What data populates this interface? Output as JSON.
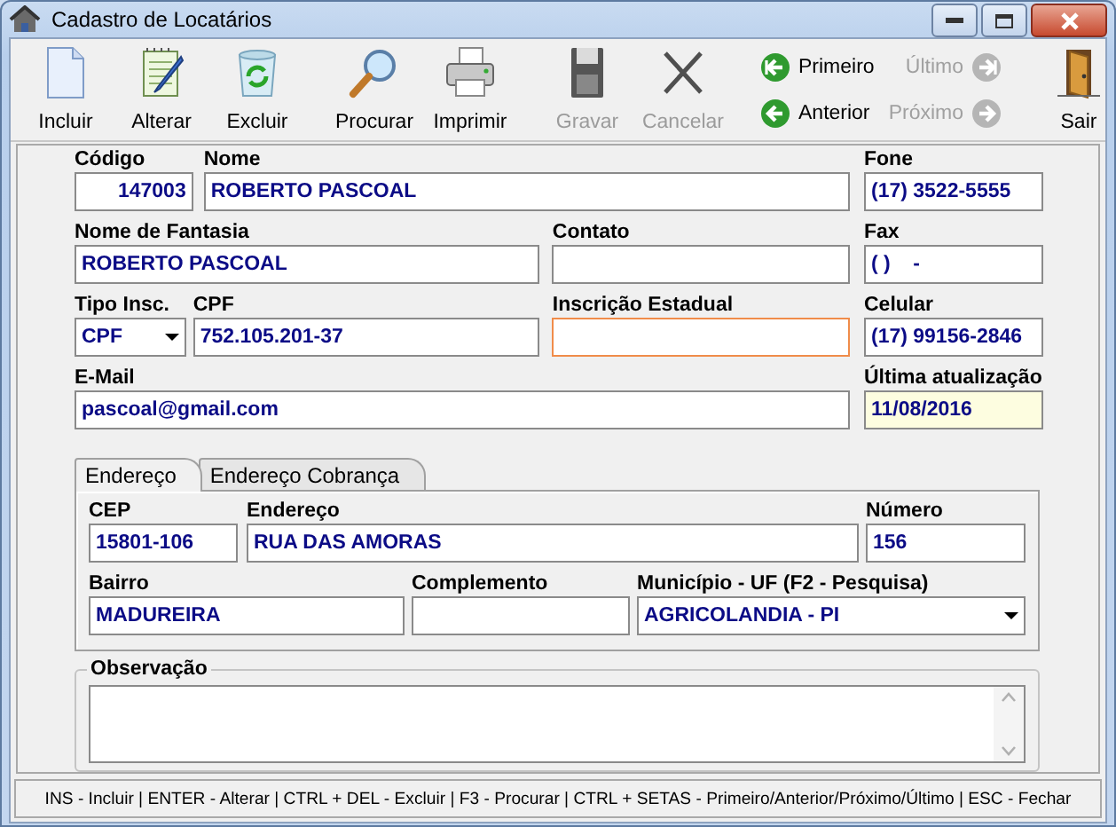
{
  "window": {
    "title": "Cadastro de Locatários"
  },
  "toolbar": {
    "groups": [
      {
        "kind": "buttons",
        "buttons": [
          {
            "label": "Incluir",
            "disabled": false
          },
          {
            "label": "Alterar",
            "disabled": false
          },
          {
            "label": "Excluir",
            "disabled": false
          }
        ]
      },
      {
        "kind": "buttons",
        "buttons": [
          {
            "label": "Procurar",
            "disabled": false
          },
          {
            "label": "Imprimir",
            "disabled": false
          }
        ]
      },
      {
        "kind": "buttons",
        "buttons": [
          {
            "label": "Gravar",
            "disabled": true
          },
          {
            "label": "Cancelar",
            "disabled": true
          }
        ]
      },
      {
        "kind": "navigation",
        "buttons": [
          {
            "label": "Primeiro",
            "disabled": false
          },
          {
            "label": "Último",
            "disabled": true
          },
          {
            "label": "Anterior",
            "disabled": false
          },
          {
            "label": "Próximo",
            "disabled": true
          }
        ]
      },
      {
        "kind": "buttons",
        "buttons": [
          {
            "label": "Sair",
            "disabled": false
          }
        ]
      }
    ]
  },
  "form": {
    "name_row": [
      {
        "label": "Código",
        "value": "147003",
        "kind": "text",
        "focused": false,
        "readonly": false
      },
      {
        "label": "Nome",
        "value": "ROBERTO PASCOAL",
        "kind": "text",
        "focused": false,
        "readonly": false
      }
    ],
    "trade_name_row": [
      {
        "label": "Nome de Fantasia",
        "value": "ROBERTO PASCOAL",
        "kind": "text",
        "focused": false,
        "readonly": false
      },
      {
        "label": "Contato",
        "kind": "text",
        "focused": false,
        "readonly": false
      }
    ],
    "document_row": [
      {
        "label": "Tipo Insc.",
        "value": "CPF",
        "kind": "dropdown",
        "focused": false,
        "readonly": false
      },
      {
        "label": "CPF",
        "value": "752.105.201-37",
        "kind": "text",
        "focused": false,
        "readonly": false
      },
      {
        "label": "Inscrição Estadual",
        "kind": "text",
        "focused": true,
        "readonly": false
      }
    ],
    "email_row": [
      {
        "label": "E-Mail",
        "value": "pascoal@gmail.com",
        "kind": "text",
        "focused": false,
        "readonly": false
      }
    ],
    "right_column": [
      {
        "label": "Fone",
        "value": "(17) 3522-5555",
        "kind": "text",
        "focused": false,
        "readonly": false
      },
      {
        "label": "Fax",
        "value": "( )    -",
        "kind": "text",
        "focused": false,
        "readonly": false
      },
      {
        "label": "Celular",
        "value": "(17) 99156-2846",
        "kind": "text",
        "focused": false,
        "readonly": false
      },
      {
        "label": "Última atualização",
        "value": "11/08/2016",
        "kind": "text",
        "focused": false,
        "readonly": true
      }
    ]
  },
  "tabs": [
    {
      "label": "Endereço",
      "selected": true
    },
    {
      "label": "Endereço Cobrança",
      "selected": false
    }
  ],
  "address": {
    "rows": [
      [
        {
          "label": "CEP",
          "value": "15801-106",
          "kind": "text",
          "focused": false,
          "readonly": false
        },
        {
          "label": "Endereço",
          "value": "RUA DAS AMORAS",
          "kind": "text",
          "focused": false,
          "readonly": false
        },
        {
          "label": "Número",
          "value": "156",
          "kind": "text",
          "focused": false,
          "readonly": false
        }
      ],
      [
        {
          "label": "Bairro",
          "value": "MADUREIRA",
          "kind": "text",
          "focused": false,
          "readonly": false
        },
        {
          "label": "Complemento",
          "kind": "text",
          "focused": false,
          "readonly": false
        },
        {
          "label": "Município - UF (F2 - Pesquisa)",
          "value": "AGRICOLANDIA - PI",
          "kind": "dropdown",
          "focused": false,
          "readonly": false
        }
      ]
    ]
  },
  "observation": {
    "label": "Observação"
  },
  "status_bar": {
    "text": "INS - Incluir | ENTER - Alterar | CTRL + DEL - Excluir | F3 - Procurar | CTRL + SETAS - Primeiro/Anterior/Próximo/Último | ESC - Fechar"
  }
}
